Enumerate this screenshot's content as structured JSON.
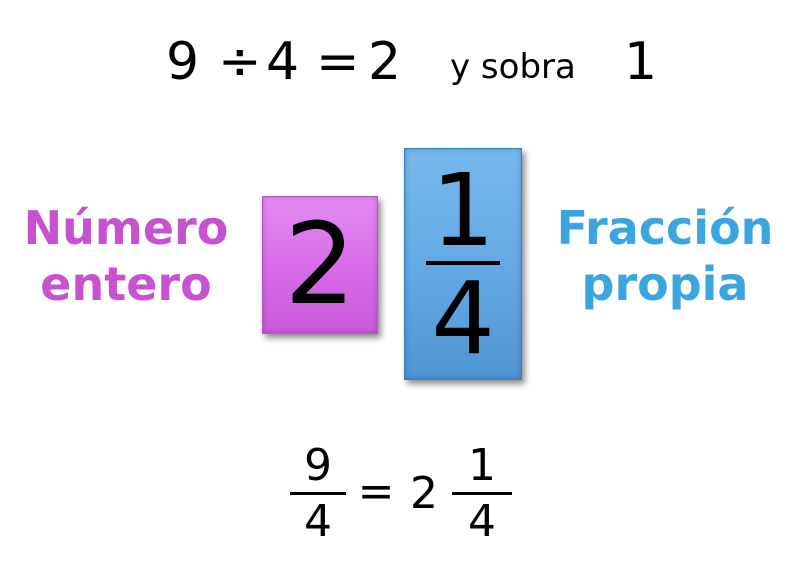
{
  "colors": {
    "whole": "#c752cf",
    "fraction": "#3aa6e0",
    "whole_box": "#d76ae8",
    "fraction_box": "#62a9e4"
  },
  "top_equation": {
    "dividend": "9",
    "division_sign": "÷",
    "divisor": "4",
    "equals": "=",
    "quotient": "2",
    "remainder_text": "y sobra",
    "remainder": "1"
  },
  "labels": {
    "whole_line1": "Número",
    "whole_line2": "entero",
    "fraction_line1": "Fracción",
    "fraction_line2": "propia"
  },
  "mixed_number": {
    "whole": "2",
    "numerator": "1",
    "denominator": "4"
  },
  "bottom_equation": {
    "improper_numerator": "9",
    "improper_denominator": "4",
    "equals": "=",
    "whole": "2",
    "numerator": "1",
    "denominator": "4"
  }
}
